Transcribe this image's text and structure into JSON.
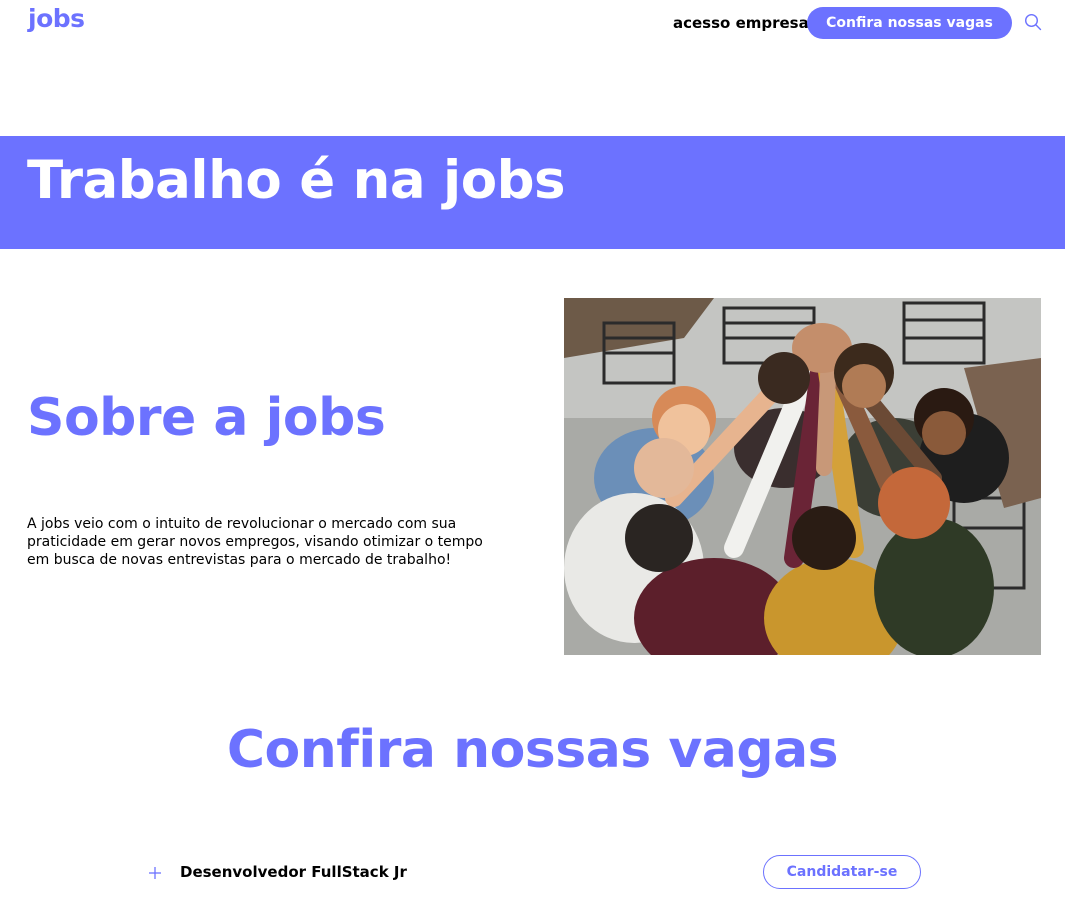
{
  "header": {
    "logo": "jobs",
    "company_access": "acesso empresa",
    "cta_label": "Confira nossas vagas",
    "search_icon": "search-icon"
  },
  "hero": {
    "title": "Trabalho é na jobs"
  },
  "about": {
    "title": "Sobre a jobs",
    "text": "A jobs veio com o intuito de revolucionar o mercado com sua praticidade em gerar novos empregos, visando otimizar o tempo em busca de novas entrevistas para o mercado de trabalho!"
  },
  "vagas": {
    "title": "Confira nossas vagas",
    "jobs": [
      {
        "title": "Desenvolvedor FullStack Jr",
        "apply_label": "Candidatar-se",
        "expand_icon": "plus-icon"
      }
    ]
  },
  "colors": {
    "accent": "#6C72FF"
  }
}
